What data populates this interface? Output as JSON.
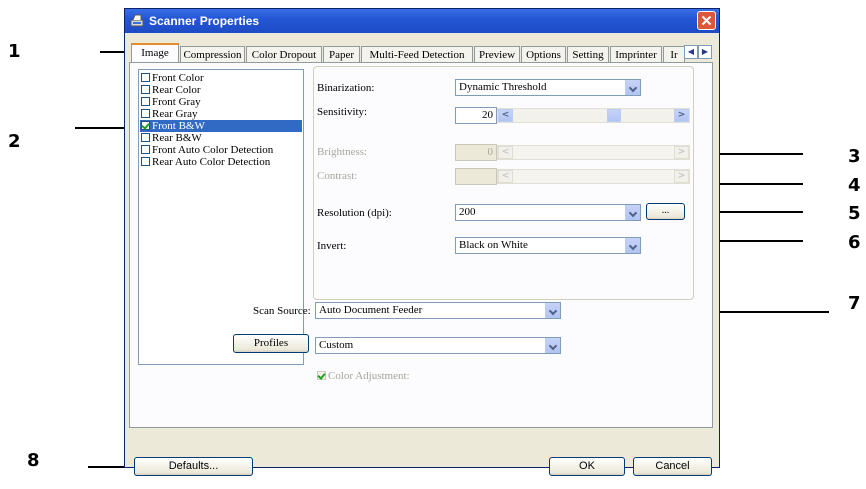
{
  "window": {
    "title": "Scanner Properties"
  },
  "tabs": [
    "Image",
    "Compression",
    "Color Dropout",
    "Paper",
    "Multi-Feed Detection",
    "Preview",
    "Options",
    "Setting",
    "Imprinter",
    "Ir"
  ],
  "image_types": [
    {
      "label": "Front Color",
      "checked": false,
      "selected": false
    },
    {
      "label": "Rear Color",
      "checked": false,
      "selected": false
    },
    {
      "label": "Front Gray",
      "checked": false,
      "selected": false
    },
    {
      "label": "Rear Gray",
      "checked": false,
      "selected": false
    },
    {
      "label": "Front B&W",
      "checked": true,
      "selected": true
    },
    {
      "label": "Rear B&W",
      "checked": false,
      "selected": false
    },
    {
      "label": "Front Auto Color Detection",
      "checked": false,
      "selected": false
    },
    {
      "label": "Rear Auto Color Detection",
      "checked": false,
      "selected": false
    }
  ],
  "settings": {
    "binarization_label": "Binarization:",
    "binarization_value": "Dynamic Threshold",
    "sensitivity_label": "Sensitivity:",
    "sensitivity_value": "20",
    "brightness_label": "Brightness:",
    "brightness_value": "0",
    "contrast_label": "Contrast:",
    "resolution_label": "Resolution (dpi):",
    "resolution_value": "200",
    "more_button": "...",
    "invert_label": "Invert:",
    "invert_value": "Black on White"
  },
  "scan": {
    "source_label": "Scan Source:",
    "source_value": "Auto Document Feeder",
    "profiles_button": "Profiles",
    "profile_value": "Custom",
    "color_adjustment_label": "Color Adjustment:"
  },
  "footer": {
    "defaults": "Defaults...",
    "ok": "OK",
    "cancel": "Cancel"
  },
  "callouts": [
    "1",
    "2",
    "3",
    "4",
    "5",
    "6",
    "7",
    "8"
  ],
  "colors": {
    "title_bar": "#2456d4",
    "selection": "#316ac5",
    "active_tab_accent": "#e68b2c",
    "close_button": "#e0563a"
  },
  "icons": [
    "scanner-app-icon",
    "close-icon",
    "tab-scroll-left-icon",
    "tab-scroll-right-icon",
    "dropdown-arrow-icon",
    "scroll-left-arrow-icon",
    "scroll-right-arrow-icon",
    "checkbox-icon"
  ]
}
